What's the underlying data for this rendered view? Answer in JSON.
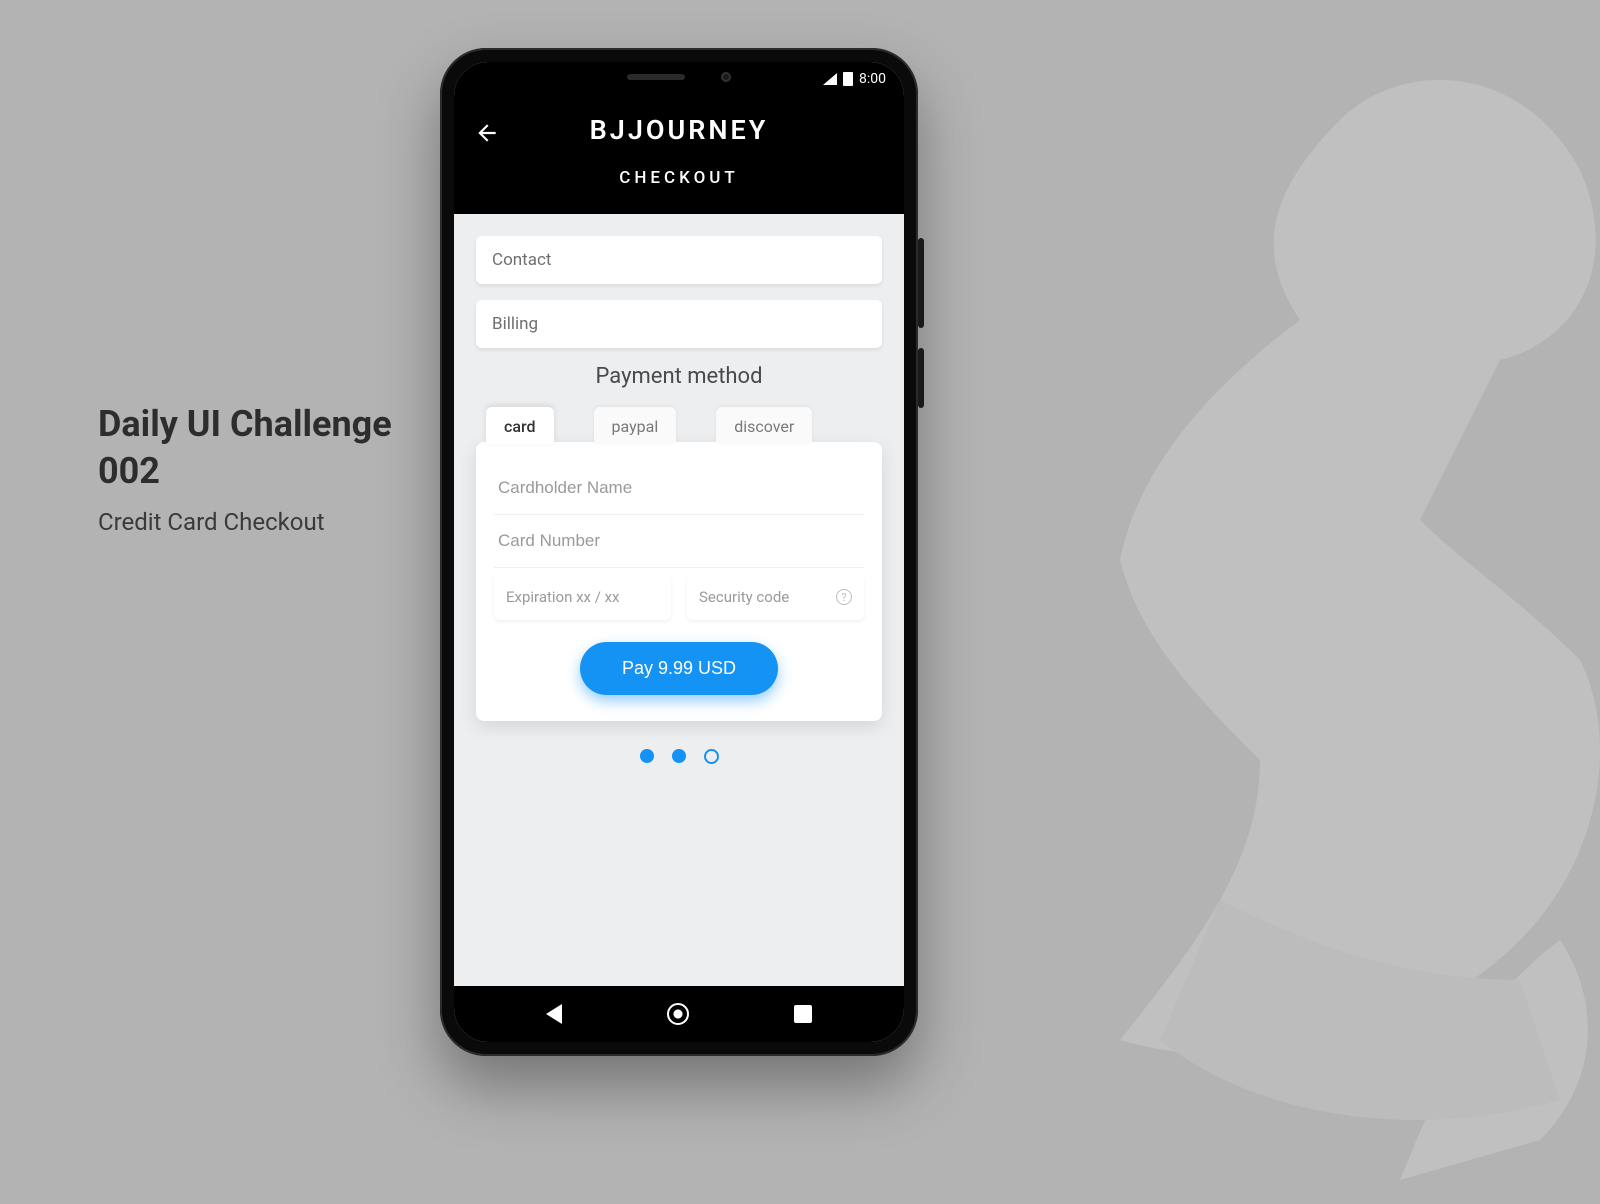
{
  "background": {
    "caption_title_line1": "Daily UI Challenge",
    "caption_title_line2": "002",
    "caption_subtitle": "Credit Card Checkout"
  },
  "statusbar": {
    "time": "8:00"
  },
  "app": {
    "brand": "BJJOURNEY",
    "subtitle": "CHECKOUT"
  },
  "form": {
    "contact_placeholder": "Contact",
    "billing_placeholder": "Billing",
    "section_title": "Payment method",
    "tabs": {
      "card": "card",
      "paypal": "paypal",
      "discover": "discover"
    },
    "cardholder_placeholder": "Cardholder Name",
    "cardnumber_placeholder": "Card Number",
    "expiration_label": "Expiration  xx / xx",
    "security_label": "Security code",
    "pay_label": "Pay 9.99 USD"
  },
  "colors": {
    "accent": "#1493f4"
  }
}
